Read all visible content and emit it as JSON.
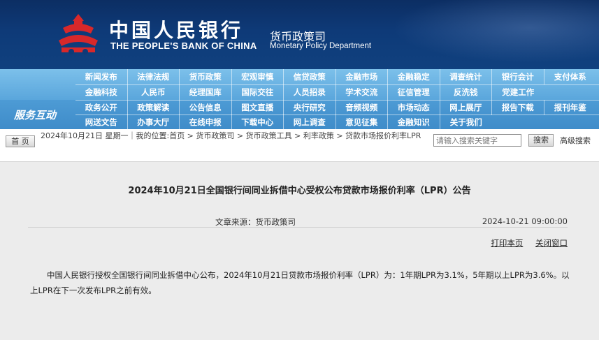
{
  "header": {
    "bank_name_cn": "中国人民银行",
    "bank_name_en": "THE PEOPLE'S BANK OF CHINA",
    "dept_cn": "货币政策司",
    "dept_en": "Monetary Policy Department",
    "logo_icon": "pboc-logo-icon"
  },
  "nav": {
    "row1": [
      "新闻发布",
      "法律法规",
      "货币政策",
      "宏观审慎",
      "信贷政策",
      "金融市场",
      "金融稳定",
      "调查统计",
      "银行会计",
      "支付体系"
    ],
    "row2": [
      "金融科技",
      "人民币",
      "经理国库",
      "国际交往",
      "人员招录",
      "学术交流",
      "征信管理",
      "反洗钱",
      "党建工作"
    ],
    "service_label": "服务互动",
    "row3": [
      "政务公开",
      "政策解读",
      "公告信息",
      "图文直播",
      "央行研究",
      "音频视频",
      "市场动态",
      "网上展厅",
      "报告下载",
      "报刊年鉴"
    ],
    "row4": [
      "网送文告",
      "办事大厅",
      "在线申报",
      "下载中心",
      "网上调查",
      "意见征集",
      "金融知识",
      "关于我们"
    ]
  },
  "location": {
    "home_label": "首 页",
    "text": "2024年10月21日 星期一｜我的位置:首页 > 货币政策司 > 货币政策工具 > 利率政策 > 贷款市场报价利率LPR",
    "search_placeholder": "请输入搜索关键字",
    "search_button": "搜索",
    "advanced_search": "高级搜索"
  },
  "article": {
    "title": "2024年10月21日全国银行间同业拆借中心受权公布贷款市场报价利率（LPR）公告",
    "source": "文章来源：货币政策司",
    "date": "2024-10-21 09:00:00",
    "print_label": "打印本页",
    "close_label": "关闭窗口",
    "body": "中国人民银行授权全国银行间同业拆借中心公布，2024年10月21日贷款市场报价利率（LPR）为：1年期LPR为3.1%，5年期以上LPR为3.6%。以上LPR在下一次发布LPR之前有效。"
  },
  "colors": {
    "banner": "#0e3a78",
    "nav": "#5aa6dc",
    "logo_red": "#d8282a",
    "content_bg": "#ececec"
  }
}
